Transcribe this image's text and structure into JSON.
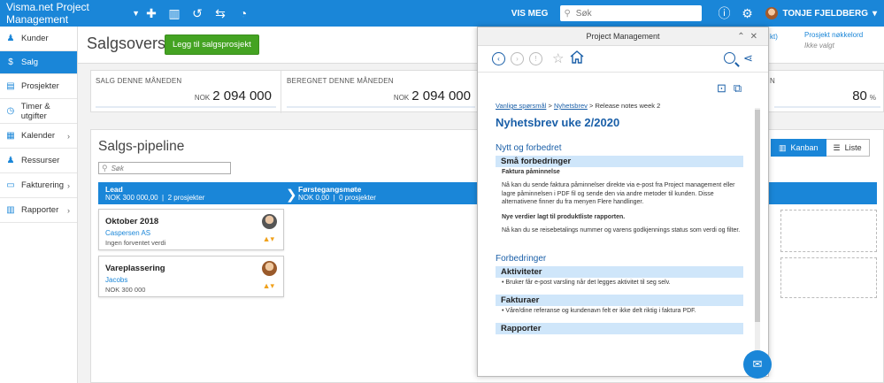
{
  "topbar": {
    "app_name": "Visma.net Project Management",
    "vis_meg": "VIS MEG",
    "search_placeholder": "Søk",
    "user_name": "TONJE FJELDBERG"
  },
  "sidebar": {
    "items": [
      {
        "label": "Kunder",
        "icon": "people-icon",
        "arrow": false
      },
      {
        "label": "Salg",
        "icon": "dollar-icon",
        "arrow": false
      },
      {
        "label": "Prosjekter",
        "icon": "project-icon",
        "arrow": false
      },
      {
        "label": "Timer & utgifter",
        "icon": "clock-icon",
        "arrow": false
      },
      {
        "label": "Kalender",
        "icon": "calendar-icon",
        "arrow": true
      },
      {
        "label": "Ressurser",
        "icon": "resource-icon",
        "arrow": false
      },
      {
        "label": "Fakturering",
        "icon": "invoice-icon",
        "arrow": true
      },
      {
        "label": "Rapporter",
        "icon": "report-icon",
        "arrow": true
      }
    ]
  },
  "page": {
    "title": "Salgsoversikt",
    "add_button": "Legg til salgsprosjekt",
    "hidden_header_fragment": "kt)",
    "key_label": "Prosjekt nøkkelord",
    "key_value": "Ikke valgt"
  },
  "kpis": [
    {
      "label": "SALG DENNE MÅNEDEN",
      "currency": "NOK",
      "value": "2 094 000"
    },
    {
      "label": "BEREGNET DENNE MÅNEDEN",
      "currency": "NOK",
      "value": "2 094 000"
    },
    {
      "label": "N",
      "value": "80",
      "unit": "%"
    }
  ],
  "pipeline": {
    "title": "Salgs-pipeline",
    "search_placeholder": "Søk",
    "view_kanban": "Kanban",
    "view_list": "Liste",
    "stages": [
      {
        "name": "Lead",
        "amount": "NOK 300 000,00",
        "count": "2 prosjekter"
      },
      {
        "name": "Førstegangsmøte",
        "amount": "NOK 0,00",
        "count": "0 prosjekter"
      }
    ],
    "deals": [
      {
        "title": "Oktober 2018",
        "customer": "Caspersen AS",
        "value": "Ingen forventet verdi"
      },
      {
        "title": "Vareplassering",
        "customer": "Jacobs",
        "value": "NOK 300 000"
      }
    ]
  },
  "help_window": {
    "title": "Project Management",
    "breadcrumb": [
      "Vanlige spørsmål",
      "Nyhetsbrev",
      "Release notes week 2"
    ],
    "heading": "Nyhetsbrev uke 2/2020",
    "section1": "Nytt og forbedret",
    "sub1": "Små forbedringer",
    "bold1": "Faktura påminnelse",
    "para1": "Nå kan du sende faktura påminnelser direkte via e-post fra Project management eller lagre påminnelsen i PDF fil og sende den via andre metoder til kunden. Disse alternativene finner du fra menyen Flere handlinger.",
    "bold2": "Nye verdier lagt til produktliste rapporten.",
    "para2": "Nå kan du se reisebetalings nummer og varens godkjennings status som verdi og filter.",
    "section2": "Forbedringer",
    "sub2": "Aktiviteter",
    "bullet2": "• Bruker får e-post varsling når det legges aktivitet til seg selv.",
    "sub3": "Fakturaer",
    "bullet3": "• Våre/dine referanse og kundenavn felt er ikke delt riktig i faktura PDF.",
    "sub4": "Rapporter"
  },
  "colors": {
    "brand": "#1a86d8",
    "add": "#44a322",
    "link": "#1a5fa8",
    "highlight": "#cfe6fa"
  }
}
